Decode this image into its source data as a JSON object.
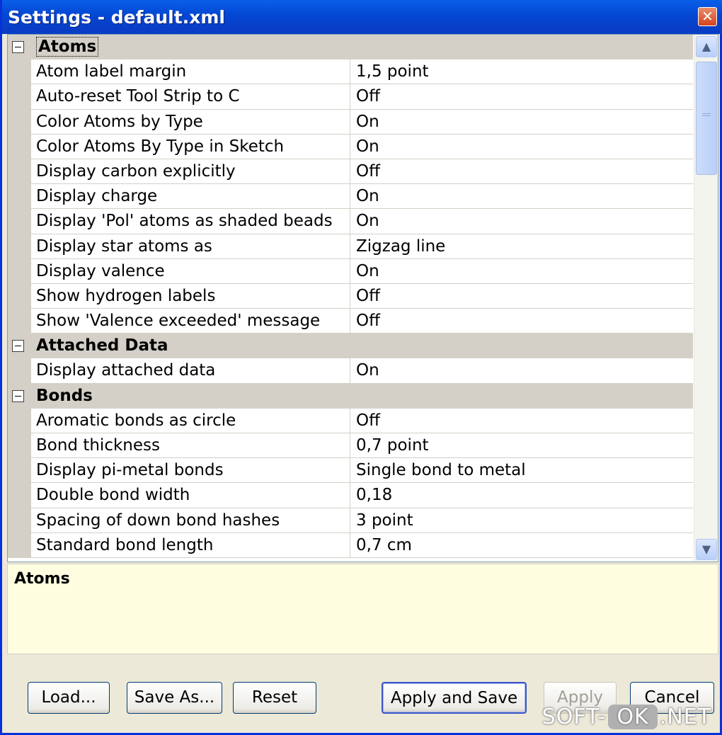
{
  "window": {
    "title": "Settings - default.xml",
    "close_glyph": "✕"
  },
  "grid": {
    "rows": [
      {
        "kind": "category",
        "label": "Atoms"
      },
      {
        "kind": "item",
        "label": "Atom label margin",
        "value": "1,5 point"
      },
      {
        "kind": "item",
        "label": "Auto-reset Tool Strip to C",
        "value": "Off"
      },
      {
        "kind": "item",
        "label": "Color Atoms by Type",
        "value": "On"
      },
      {
        "kind": "item",
        "label": "Color Atoms By Type in Sketch",
        "value": "On"
      },
      {
        "kind": "item",
        "label": "Display carbon explicitly",
        "value": "Off"
      },
      {
        "kind": "item",
        "label": "Display charge",
        "value": "On"
      },
      {
        "kind": "item",
        "label": "Display 'Pol' atoms as shaded beads",
        "value": "On"
      },
      {
        "kind": "item",
        "label": "Display star atoms as",
        "value": "Zigzag line"
      },
      {
        "kind": "item",
        "label": "Display valence",
        "value": "On"
      },
      {
        "kind": "item",
        "label": "Show hydrogen labels",
        "value": "Off"
      },
      {
        "kind": "item",
        "label": "Show 'Valence exceeded' message",
        "value": "Off"
      },
      {
        "kind": "category",
        "label": "Attached Data"
      },
      {
        "kind": "item",
        "label": "Display attached data",
        "value": "On"
      },
      {
        "kind": "category",
        "label": "Bonds"
      },
      {
        "kind": "item",
        "label": "Aromatic bonds as circle",
        "value": "Off"
      },
      {
        "kind": "item",
        "label": "Bond thickness",
        "value": "0,7 point"
      },
      {
        "kind": "item",
        "label": "Display pi-metal bonds",
        "value": "Single bond to metal"
      },
      {
        "kind": "item",
        "label": "Double bond width",
        "value": "0,18"
      },
      {
        "kind": "item",
        "label": "Spacing of down bond hashes",
        "value": "3 point"
      },
      {
        "kind": "item",
        "label": "Standard bond length",
        "value": "0,7 cm"
      }
    ]
  },
  "scrollbar": {
    "up_glyph": "▲",
    "down_glyph": "▼"
  },
  "description": {
    "title": "Atoms"
  },
  "buttons": {
    "load": "Load...",
    "save_as": "Save As...",
    "reset": "Reset",
    "apply_and_save": "Apply and Save",
    "apply": "Apply",
    "cancel": "Cancel"
  },
  "watermark": {
    "part1": "SOFT-",
    "part2": "OK",
    "part3": ".NET"
  }
}
